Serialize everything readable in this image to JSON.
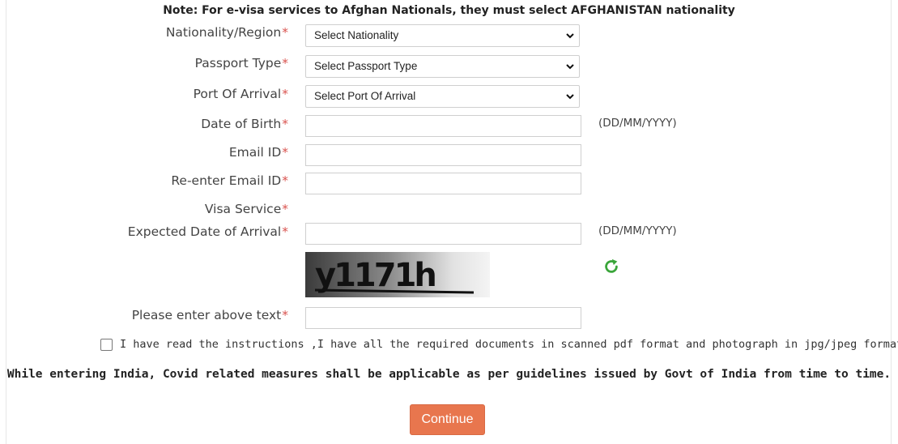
{
  "note": "Note: For e-visa services to Afghan Nationals, they must select AFGHANISTAN nationality",
  "required_marker": "*",
  "fields": {
    "nationality": {
      "label": "Nationality/Region",
      "value": "Select Nationality"
    },
    "passport_type": {
      "label": "Passport Type",
      "value": "Select Passport Type"
    },
    "port_of_arrival": {
      "label": "Port Of Arrival",
      "value": "Select Port Of Arrival"
    },
    "date_of_birth": {
      "label": "Date of Birth",
      "value": "",
      "hint": "(DD/MM/YYYY)"
    },
    "email": {
      "label": "Email ID",
      "value": ""
    },
    "email_confirm": {
      "label": "Re-enter Email ID",
      "value": ""
    },
    "visa_service": {
      "label": "Visa Service"
    },
    "expected_arrival": {
      "label": "Expected Date of Arrival",
      "value": "",
      "hint": "(DD/MM/YYYY)"
    },
    "captcha_input": {
      "label": "Please enter above text",
      "value": ""
    }
  },
  "captcha": {
    "text": "y1171h",
    "refresh_icon": "refresh-icon",
    "refresh_color": "#3aa53a"
  },
  "agreement": {
    "checked": false,
    "text": "I have read the instructions ,I have all the required documents in scanned pdf format and photograph in jpg/jpeg format."
  },
  "covid_notice": "While entering India, Covid related measures shall be applicable as per guidelines issued by Govt of India from time to time.",
  "continue_button": {
    "label": "Continue",
    "color": "#e8764e"
  }
}
